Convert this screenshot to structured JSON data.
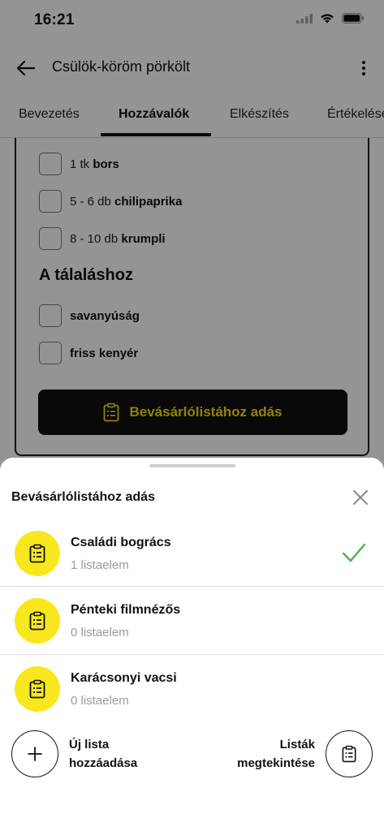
{
  "status_bar": {
    "time": "16:21"
  },
  "header": {
    "title": "Csülök-köröm pörkölt"
  },
  "tabs": [
    {
      "label": "Bevezetés"
    },
    {
      "label": "Hozzávalók"
    },
    {
      "label": "Elkészítés"
    },
    {
      "label": "Értékelése"
    }
  ],
  "ingredients": {
    "items": [
      {
        "qty": "1 tk",
        "name": "bors"
      },
      {
        "qty": "5 - 6 db",
        "name": "chilipaprika"
      },
      {
        "qty": "8 - 10 db",
        "name": "krumpli"
      }
    ],
    "section_title": "A tálaláshoz",
    "serving_items": [
      {
        "qty": "",
        "name": "savanyúság"
      },
      {
        "qty": "",
        "name": "friss kenyér"
      }
    ],
    "add_button_label": "Bevásárlólistához adás"
  },
  "sheet": {
    "title": "Bevásárlólistához adás",
    "lists": [
      {
        "name": "Családi bogrács",
        "count": "1 listaelem",
        "selected": true
      },
      {
        "name": "Pénteki filmnézős",
        "count": "0 listaelem",
        "selected": false
      },
      {
        "name": "Karácsonyi vacsi",
        "count": "0 listaelem",
        "selected": false
      }
    ],
    "new_list_line1": "Új lista",
    "new_list_line2": "hozzáadása",
    "view_lists_line1": "Listák",
    "view_lists_line2": "megtekintése"
  },
  "colors": {
    "accent_yellow": "#f8e71c",
    "button_text_yellow": "#f5e400",
    "check_green": "#4caf50"
  }
}
